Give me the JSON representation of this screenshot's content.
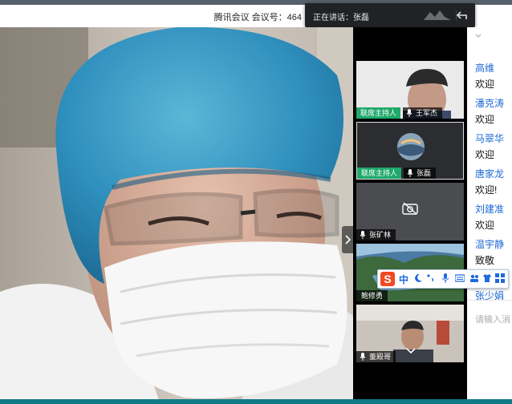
{
  "titlebar": {
    "title": "腾讯会议 会议号：464",
    "speaking_tip": "正在讲话：张磊"
  },
  "participants": [
    {
      "name": "王军杰",
      "host_tag": "联席主持人"
    },
    {
      "name": "张磊",
      "host_tag": "联席主持人"
    },
    {
      "name": "张矿林",
      "host_tag": ""
    },
    {
      "name": "鲍修勇",
      "host_tag": ""
    },
    {
      "name": "董殿哥",
      "host_tag": ""
    }
  ],
  "chat": {
    "messages": [
      {
        "name": "高维",
        "text": "欢迎"
      },
      {
        "name": "潘克涛",
        "text": "欢迎"
      },
      {
        "name": "马翠华",
        "text": "欢迎"
      },
      {
        "name": "唐家龙",
        "text": "欢迎!"
      },
      {
        "name": "刘建准",
        "text": "欢迎"
      },
      {
        "name": "温宇静",
        "text": "致敬"
      },
      {
        "name": "张少娟",
        "text": ""
      }
    ],
    "input_placeholder": "请输入消"
  },
  "ime": {
    "logo": "S",
    "mode": "中"
  },
  "icons": {
    "back": "back-arrow-icon",
    "expand": "chevron-right-icon",
    "camera_off": "camera-off-icon",
    "mic": "microphone-icon",
    "collapse": "chevron-down-icon"
  },
  "colors": {
    "host_tag": "#1fa96b",
    "chat_name": "#1c69d4",
    "ime_logo": "#f04a23"
  }
}
